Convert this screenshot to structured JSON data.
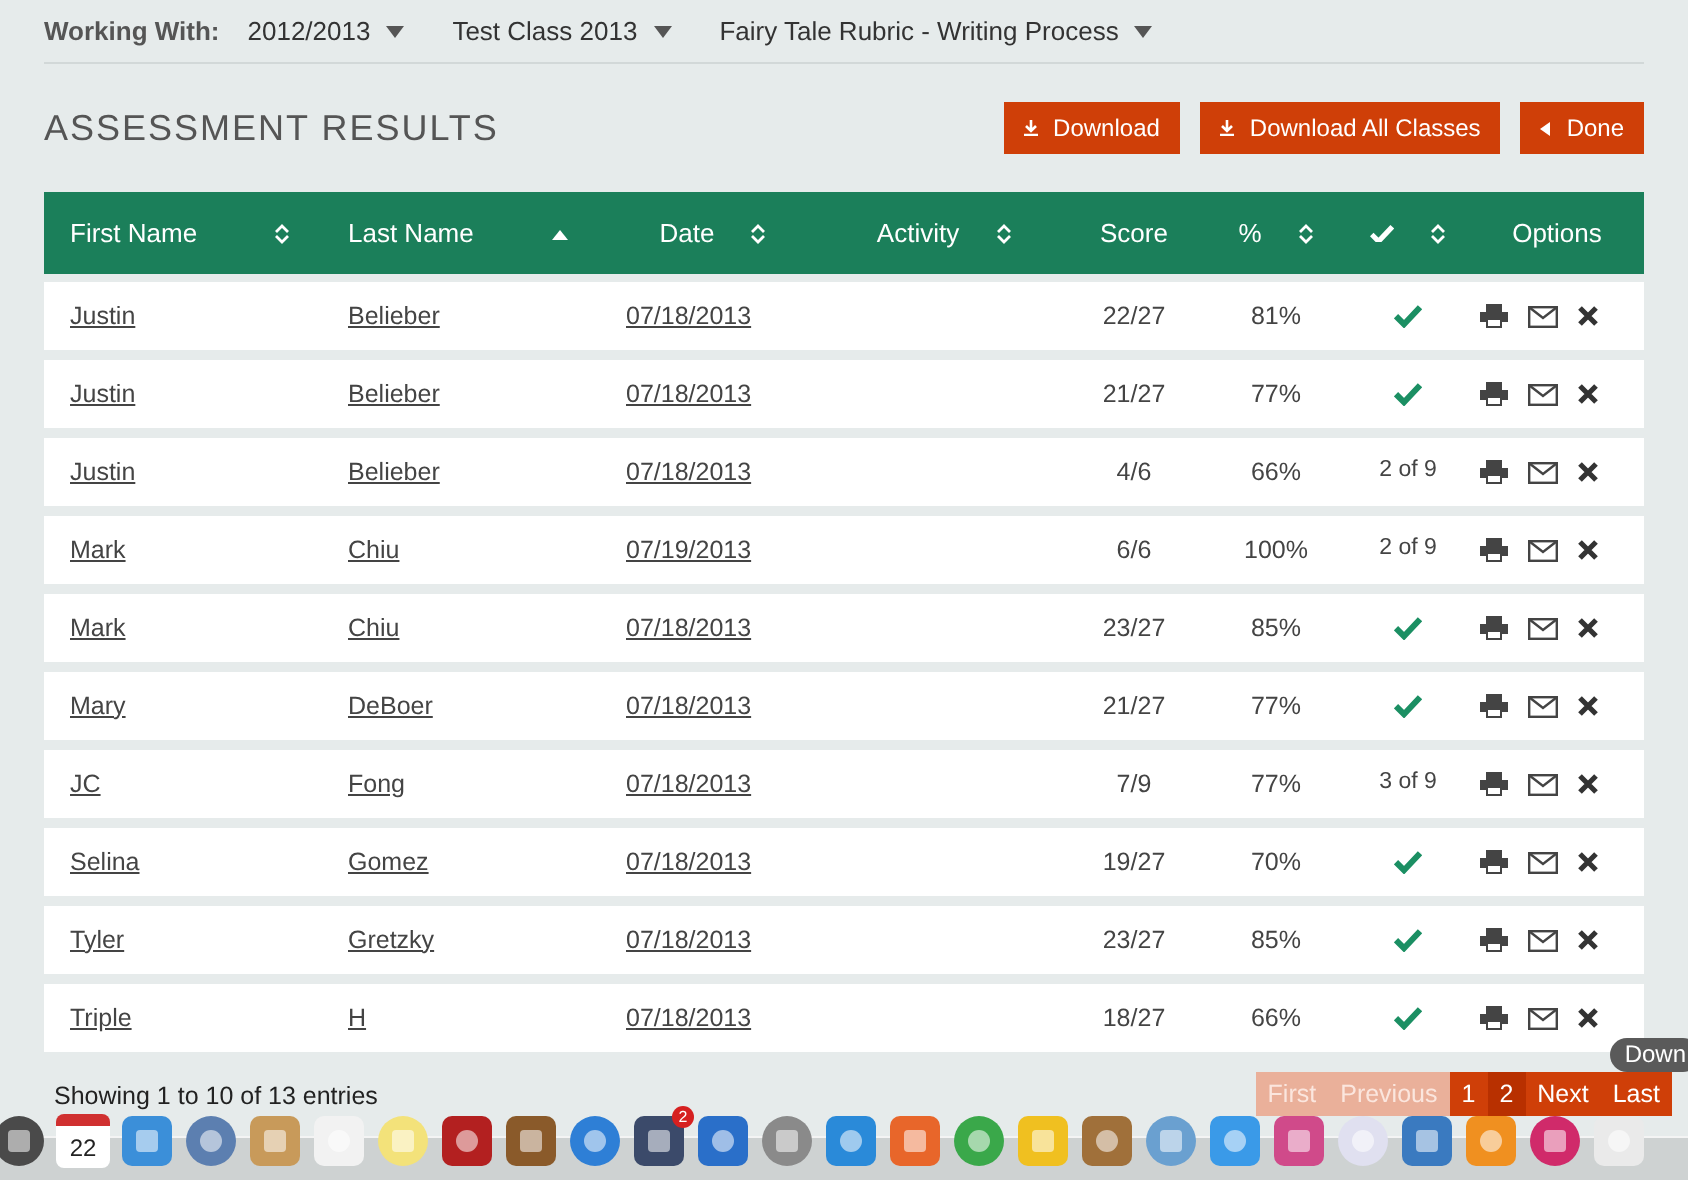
{
  "working_with": {
    "label": "Working With:",
    "selectors": [
      "2012/2013",
      "Test Class 2013",
      "Fairy Tale Rubric - Writing Process"
    ]
  },
  "title": "ASSESSMENT RESULTS",
  "actions": [
    {
      "label": "Download",
      "kind": "download"
    },
    {
      "label": "Download All Classes",
      "kind": "download"
    },
    {
      "label": "Done",
      "kind": "back"
    }
  ],
  "table": {
    "columns": [
      {
        "label": "First Name",
        "sorted": false
      },
      {
        "label": "Last Name",
        "sorted": true
      },
      {
        "label": "Date",
        "sorted": false
      },
      {
        "label": "Activity",
        "sorted": false
      },
      {
        "label": "Score"
      },
      {
        "label": "%",
        "sorted": false
      },
      {
        "kind": "check",
        "sorted": false
      },
      {
        "label": "Options"
      }
    ],
    "rows": [
      {
        "first": "Justin",
        "last": "Belieber",
        "date": "07/18/2013",
        "score": "22/27",
        "percent": "81%",
        "complete": true
      },
      {
        "first": "Justin",
        "last": "Belieber",
        "date": "07/18/2013",
        "score": "21/27",
        "percent": "77%",
        "complete": true
      },
      {
        "first": "Justin",
        "last": "Belieber",
        "date": "07/18/2013",
        "score": "4/6",
        "percent": "66%",
        "complete": false,
        "progress": "2 of 9"
      },
      {
        "first": "Mark",
        "last": "Chiu",
        "date": "07/19/2013",
        "score": "6/6",
        "percent": "100%",
        "complete": false,
        "progress": "2 of 9"
      },
      {
        "first": "Mark",
        "last": "Chiu",
        "date": "07/18/2013",
        "score": "23/27",
        "percent": "85%",
        "complete": true
      },
      {
        "first": "Mary",
        "last": "DeBoer",
        "date": "07/18/2013",
        "score": "21/27",
        "percent": "77%",
        "complete": true
      },
      {
        "first": "JC",
        "last": "Fong",
        "date": "07/18/2013",
        "score": "7/9",
        "percent": "77%",
        "complete": false,
        "progress": "3 of 9"
      },
      {
        "first": "Selina",
        "last": "Gomez",
        "date": "07/18/2013",
        "score": "19/27",
        "percent": "70%",
        "complete": true
      },
      {
        "first": "Tyler",
        "last": "Gretzky",
        "date": "07/18/2013",
        "score": "23/27",
        "percent": "85%",
        "complete": true
      },
      {
        "first": "Triple",
        "last": "H",
        "date": "07/18/2013",
        "score": "18/27",
        "percent": "66%",
        "complete": true
      }
    ]
  },
  "footer": {
    "info": "Showing 1 to 10 of 13 entries",
    "pages": [
      {
        "label": "First",
        "disabled": true,
        "selected": false
      },
      {
        "label": "Previous",
        "disabled": true,
        "selected": false
      },
      {
        "label": "1",
        "disabled": false,
        "selected": false
      },
      {
        "label": "2",
        "disabled": false,
        "selected": true
      },
      {
        "label": "Next",
        "disabled": false,
        "selected": false
      },
      {
        "label": "Last",
        "disabled": false,
        "selected": false
      }
    ]
  },
  "dock": {
    "calendar_day": "22",
    "badge": "2",
    "tooltip": "Down"
  }
}
